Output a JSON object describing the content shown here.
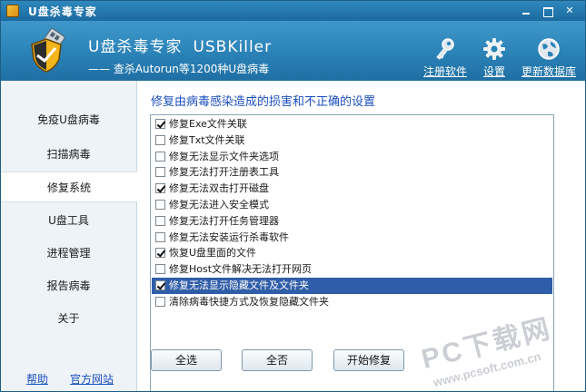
{
  "window": {
    "title": "U盘杀毒专家"
  },
  "header": {
    "brand_cn": "U盘杀毒专家",
    "brand_en": "USBKiller",
    "slogan": "—— 查杀Autorun等1200种U盘病毒",
    "tools": {
      "register": "注册软件",
      "settings": "设置",
      "update": "更新数据库"
    }
  },
  "sidebar": {
    "items": [
      {
        "label": "免疫U盘病毒"
      },
      {
        "label": "扫描病毒"
      },
      {
        "label": "修复系统"
      },
      {
        "label": "U盘工具"
      },
      {
        "label": "进程管理"
      },
      {
        "label": "报告病毒"
      },
      {
        "label": "关于"
      }
    ],
    "active_index": 2,
    "footer": {
      "help": "帮助",
      "website": "官方网站"
    }
  },
  "main": {
    "title": "修复由病毒感染造成的损害和不正确的设置",
    "options": [
      {
        "label": "修复Exe文件关联",
        "checked": true
      },
      {
        "label": "修复Txt文件关联",
        "checked": false
      },
      {
        "label": "修复无法显示文件夹选项",
        "checked": false
      },
      {
        "label": "修复无法打开注册表工具",
        "checked": false
      },
      {
        "label": "修复无法双击打开磁盘",
        "checked": true
      },
      {
        "label": "修复无法进入安全模式",
        "checked": false
      },
      {
        "label": "修复无法打开任务管理器",
        "checked": false
      },
      {
        "label": "修复无法安装运行杀毒软件",
        "checked": false
      },
      {
        "label": "恢复U盘里面的文件",
        "checked": true
      },
      {
        "label": "修复Host文件解决无法打开网页",
        "checked": false
      },
      {
        "label": "修复无法显示隐藏文件及文件夹",
        "checked": true,
        "selected": true
      },
      {
        "label": "清除病毒快捷方式及恢复隐藏文件夹",
        "checked": false
      }
    ],
    "buttons": {
      "select_all": "全选",
      "select_none": "全否",
      "start_repair": "开始修复"
    }
  },
  "watermark": {
    "line1": "PC下载网",
    "line2": "www.pcsoft.com.cn"
  },
  "colors": {
    "titlebar": "#1b6aa0",
    "header": "#2a82b7",
    "link": "#1b4fbf",
    "selection": "#2f5da8"
  }
}
